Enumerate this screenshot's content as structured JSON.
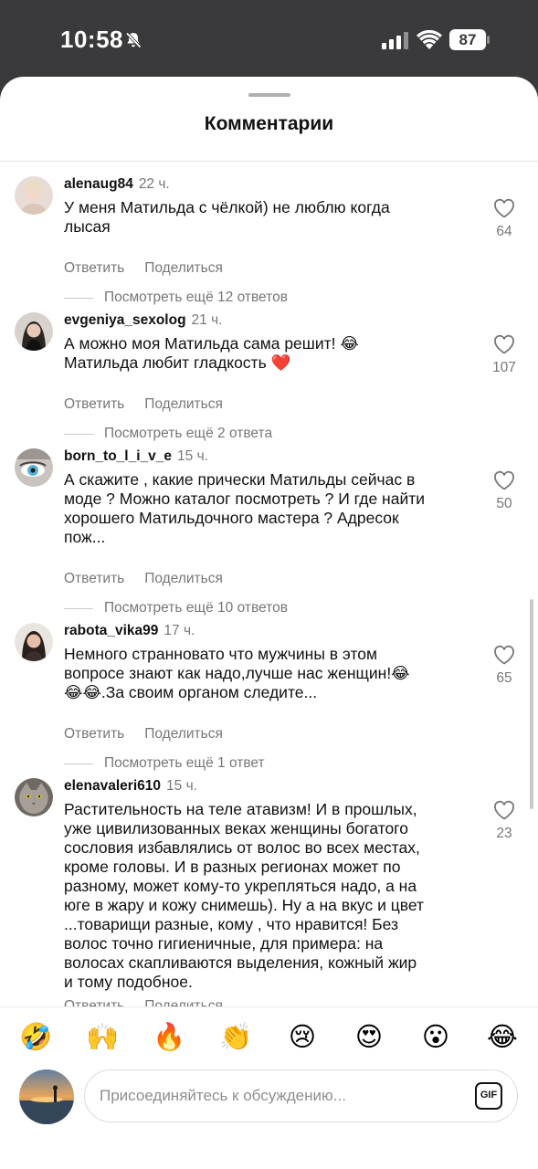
{
  "status_bar": {
    "time": "10:58",
    "battery": "87"
  },
  "sheet": {
    "title": "Комментарии"
  },
  "comments": [
    {
      "username": "alenaug84",
      "time_ago": "22 ч.",
      "lines": [
        "У меня Матильда с чёлкой) не люблю когда",
        "лысая"
      ],
      "likes": "64",
      "reply_label": "Ответить",
      "share_label": "Поделиться",
      "view_replies": "Посмотреть ещё 12 ответов"
    },
    {
      "username": "evgeniya_sexolog",
      "time_ago": "21 ч.",
      "lines": [
        "А можно моя Матильда сама решит! 😂",
        "Матильда любит гладкость ❤️"
      ],
      "likes": "107",
      "reply_label": "Ответить",
      "share_label": "Поделиться",
      "view_replies": "Посмотреть ещё 2 ответа"
    },
    {
      "username": "born_to_l_i_v_e",
      "time_ago": "15 ч.",
      "lines": [
        "А скажите , какие прически Матильды сейчас в",
        "моде ? Можно каталог посмотреть ? И где найти",
        "хорошего Матильдочного мастера ? Адресок",
        "пож..."
      ],
      "likes": "50",
      "reply_label": "Ответить",
      "share_label": "Поделиться",
      "view_replies": "Посмотреть ещё 10 ответов"
    },
    {
      "username": "rabota_vika99",
      "time_ago": "17 ч.",
      "lines": [
        "Немного странновато что мужчины в этом",
        "вопросе знают как надо,лучше нас женщин!😂",
        "😂😂.За своим органом следите..."
      ],
      "likes": "65",
      "reply_label": "Ответить",
      "share_label": "Поделиться",
      "view_replies": "Посмотреть ещё 1 ответ"
    },
    {
      "username": "elenavaleri610",
      "time_ago": "15 ч.",
      "lines": [
        "Растительность на теле атавизм! И в прошлых,",
        "уже цивилизованных веках женщины богатого",
        "сословия избавлялись от волос во всех местах,",
        "кроме головы. И в разных регионах может по",
        "разному, может кому-то  укрепляться надо, а на",
        "юге в жару и кожу снимешь). Ну а на вкус и цвет",
        "...товарищи разные, кому , что нравится! Без",
        "волос точно гигиеничные, для примера: на",
        "волосах скапливаются выделения, кожный жир",
        "и тому подобное."
      ],
      "likes": "23",
      "reply_label": "Ответить",
      "share_label": "Поделиться"
    }
  ],
  "emoji_bar": [
    "🤣",
    "🙌",
    "🔥",
    "👏",
    "😢",
    "😍",
    "😮",
    "😂"
  ],
  "composer": {
    "placeholder": "Присоединяйтесь к обсуждению...",
    "gif_label": "GIF"
  }
}
